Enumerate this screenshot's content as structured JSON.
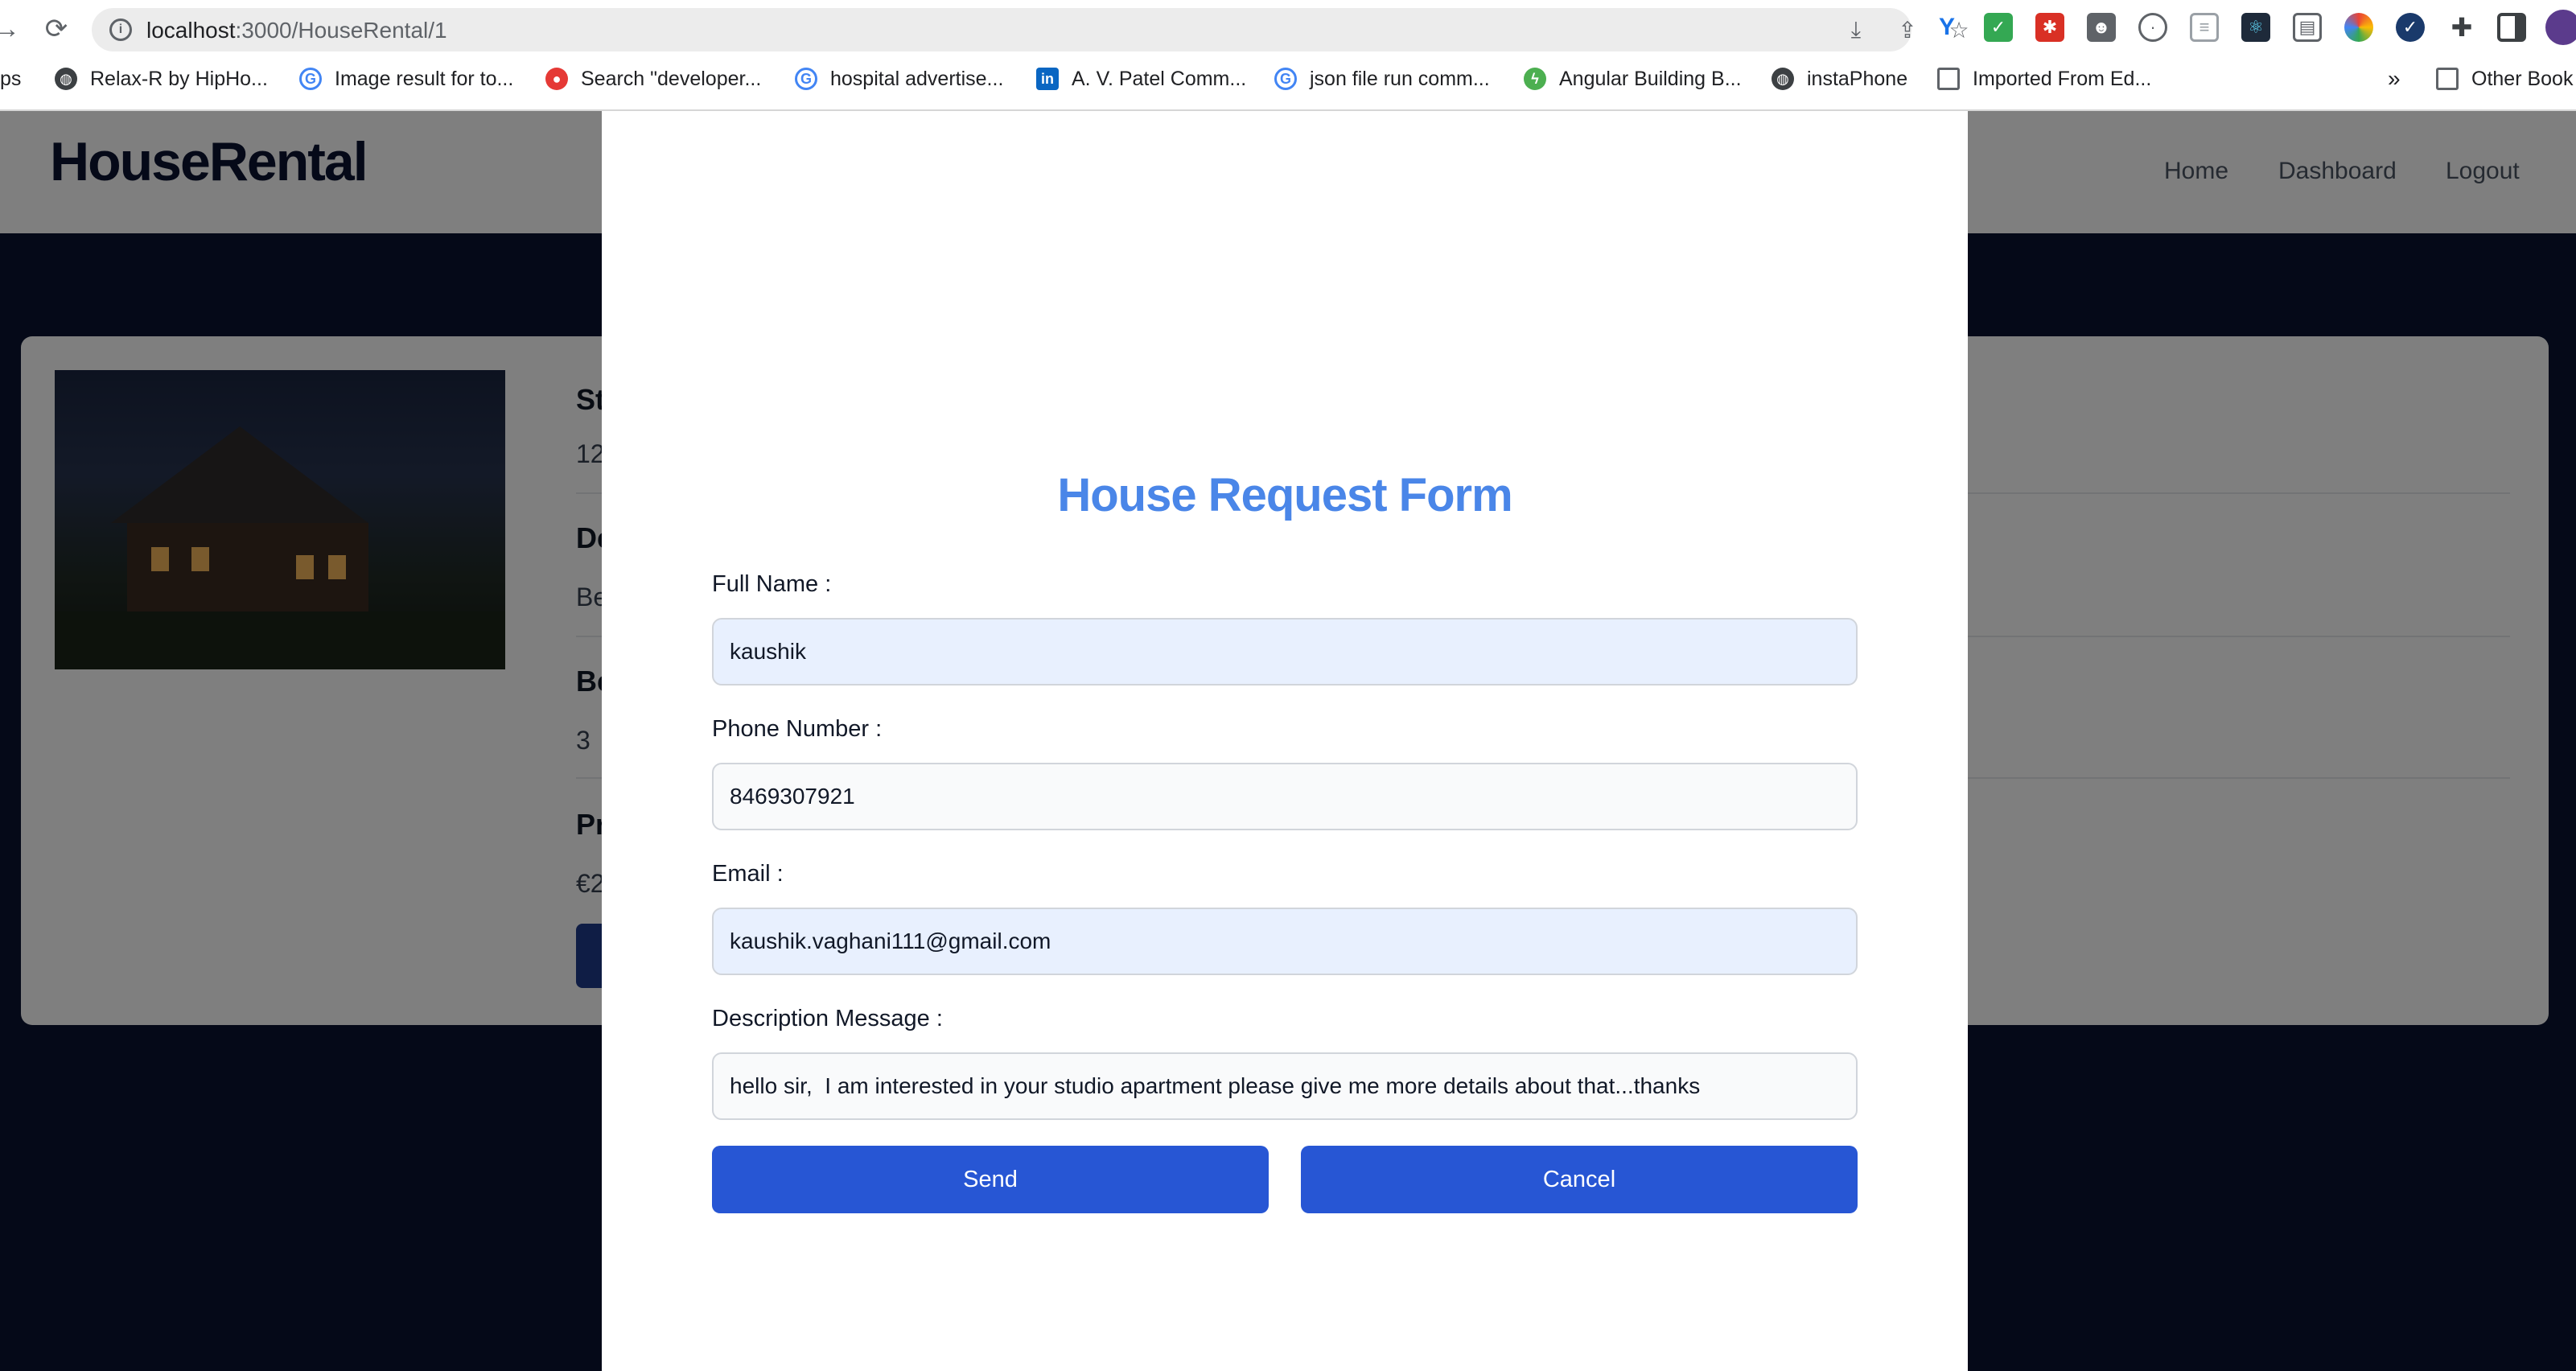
{
  "browser": {
    "url_host": "localhost",
    "url_path": ":3000/HouseRental/1",
    "bookmarks": [
      {
        "label": "ps",
        "icon": "apps-icon"
      },
      {
        "label": "Relax-R  by HipHo...",
        "icon": "globe-icon"
      },
      {
        "label": "Image result for to...",
        "icon": "google-icon"
      },
      {
        "label": "Search \"developer...",
        "icon": "red-circle-icon"
      },
      {
        "label": "hospital advertise...",
        "icon": "google-icon"
      },
      {
        "label": "A. V. Patel Comm...",
        "icon": "linkedin-icon"
      },
      {
        "label": "json file run comm...",
        "icon": "google-icon"
      },
      {
        "label": "Angular Building B...",
        "icon": "bolt-icon"
      },
      {
        "label": "instaPhone",
        "icon": "globe-icon"
      },
      {
        "label": "Imported From Ed...",
        "icon": "folder-icon"
      },
      {
        "label": "Other Book",
        "icon": "folder-icon"
      }
    ],
    "overflow_label": "»"
  },
  "app": {
    "logo": "HouseRental",
    "nav": [
      "Home",
      "Dashboard",
      "Logout"
    ],
    "details": {
      "title_partial": "St",
      "subtitle_partial": "12",
      "desc_heading_partial": "De",
      "desc_partial": "Be",
      "bed_heading_partial": "Be",
      "bed_value": "3",
      "price_heading_partial": "Pr",
      "price_partial": "€2"
    }
  },
  "modal": {
    "title": "House Request Form",
    "fields": {
      "full_name": {
        "label": "Full Name :",
        "value": "kaushik"
      },
      "phone": {
        "label": "Phone Number :",
        "value": "8469307921"
      },
      "email": {
        "label": "Email :",
        "value": "kaushik.vaghani111@gmail.com"
      },
      "description": {
        "label": "Description Message :",
        "value": "hello sir,  I am interested in your studio apartment please give me more details about that...thanks"
      }
    },
    "send_label": "Send",
    "cancel_label": "Cancel"
  },
  "colors": {
    "title_blue": "#4a86e8",
    "button_blue": "#2756d4",
    "navy": "#0b1330",
    "autofill": "#e8f0fe"
  }
}
